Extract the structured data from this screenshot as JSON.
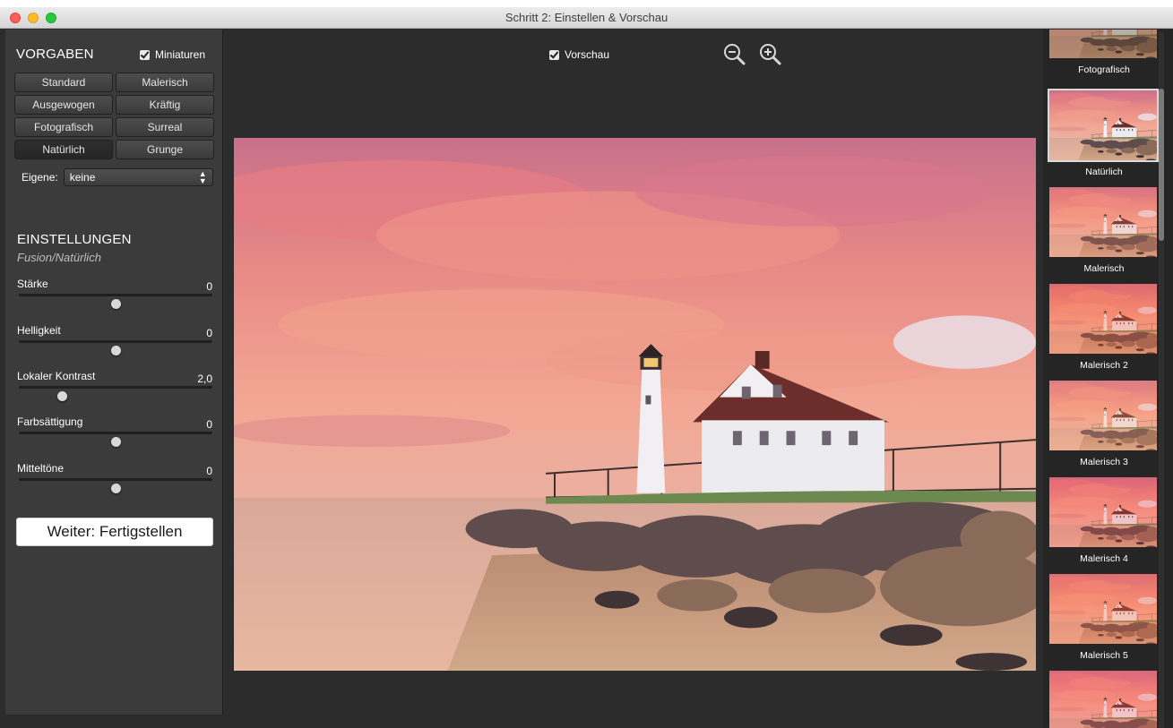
{
  "window": {
    "title": "Schritt 2: Einstellen & Vorschau"
  },
  "presets": {
    "title": "VORGABEN",
    "thumbnails_label": "Miniaturen",
    "thumbnails_checked": true,
    "buttons": [
      {
        "label": "Standard",
        "active": false
      },
      {
        "label": "Malerisch",
        "active": false
      },
      {
        "label": "Ausgewogen",
        "active": false
      },
      {
        "label": "Kräftig",
        "active": false
      },
      {
        "label": "Fotografisch",
        "active": false
      },
      {
        "label": "Surreal",
        "active": false
      },
      {
        "label": "Natürlich",
        "active": true
      },
      {
        "label": "Grunge",
        "active": false
      }
    ],
    "custom_label": "Eigene:",
    "custom_value": "keine"
  },
  "settings": {
    "title": "EINSTELLUNGEN",
    "subtitle": "Fusion/Natürlich",
    "sliders": [
      {
        "label": "Stärke",
        "value": "0",
        "level": 0.5
      },
      {
        "label": "Helligkeit",
        "value": "0",
        "level": 0.5
      },
      {
        "label": "Lokaler Kontrast",
        "value": "2,0",
        "level": 0.22
      },
      {
        "label": "Farbsättigung",
        "value": "0",
        "level": 0.5
      },
      {
        "label": "Mitteltöne",
        "value": "0",
        "level": 0.5
      }
    ]
  },
  "actions": {
    "next_label": "Weiter: Fertigstellen"
  },
  "preview": {
    "toggle_label": "Vorschau",
    "toggle_checked": true,
    "zoom_out_icon": "zoom-out-icon",
    "zoom_in_icon": "zoom-in-icon"
  },
  "thumbnails": [
    {
      "label": "Fotografisch",
      "style": "photo",
      "selected": false
    },
    {
      "label": "Natürlich",
      "style": "natural",
      "selected": true
    },
    {
      "label": "Malerisch",
      "style": "paint1",
      "selected": false
    },
    {
      "label": "Malerisch 2",
      "style": "paint2",
      "selected": false
    },
    {
      "label": "Malerisch 3",
      "style": "paint3",
      "selected": false
    },
    {
      "label": "Malerisch 4",
      "style": "paint4",
      "selected": false
    },
    {
      "label": "Malerisch 5",
      "style": "paint5",
      "selected": false
    },
    {
      "label": "",
      "style": "paint6",
      "selected": false
    }
  ],
  "colors": {
    "panel_bg": "#3b3b3b",
    "window_bg": "#2c2c2c",
    "accent_sky": "#f08a86"
  }
}
